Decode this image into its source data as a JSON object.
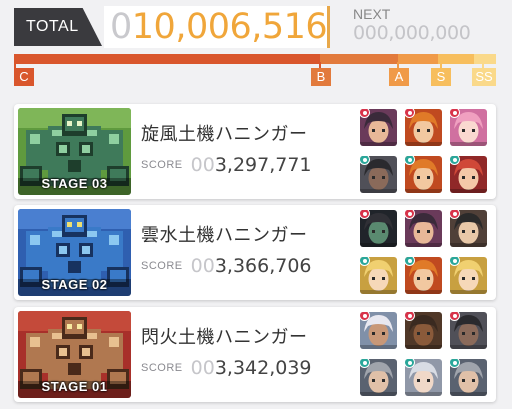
{
  "header": {
    "total_label": "TOTAL",
    "total_lead": "0",
    "total_value": "10,006,516",
    "next_label": "NEXT",
    "next_value": "000,000,000"
  },
  "rank_bar": {
    "colors": {
      "c": "#d9562c",
      "b": "#e27a3c",
      "a": "#f09a48",
      "s": "#f7be5d",
      "ss": "#fad98a"
    },
    "ranks": [
      "C",
      "B",
      "A",
      "S",
      "SS"
    ]
  },
  "stages": [
    {
      "stage_label": "STAGE 03",
      "boss_name": "旋風土機ハニンガー",
      "score_label": "SCORE",
      "score_lead": "00",
      "score_value": "3,297,771",
      "theme": "green",
      "party": [
        {
          "mark": "red",
          "tone": "dark-hair-character"
        },
        {
          "mark": "red",
          "tone": "orange-hair-character"
        },
        {
          "mark": "red",
          "tone": "pink-hair-character"
        },
        {
          "mark": "teal",
          "tone": "dark-character"
        },
        {
          "mark": "teal",
          "tone": "orange-hair-character"
        },
        {
          "mark": "teal",
          "tone": "red-hair-character"
        }
      ]
    },
    {
      "stage_label": "STAGE 02",
      "boss_name": "雲水土機ハニンガー",
      "score_label": "SCORE",
      "score_lead": "00",
      "score_value": "3,366,706",
      "theme": "blue",
      "party": [
        {
          "mark": "red",
          "tone": "masked-character"
        },
        {
          "mark": "red",
          "tone": "dark-hair-character"
        },
        {
          "mark": "red",
          "tone": "glasses-character"
        },
        {
          "mark": "teal",
          "tone": "blonde-character"
        },
        {
          "mark": "teal",
          "tone": "orange-hair-character"
        },
        {
          "mark": "teal",
          "tone": "blonde-character"
        }
      ]
    },
    {
      "stage_label": "STAGE 01",
      "boss_name": "閃火土機ハニンガー",
      "score_label": "SCORE",
      "score_lead": "00",
      "score_value": "3,342,039",
      "theme": "red",
      "party": [
        {
          "mark": "red",
          "tone": "white-hair-character"
        },
        {
          "mark": "red",
          "tone": "dark-skin-character"
        },
        {
          "mark": "red",
          "tone": "dark-character"
        },
        {
          "mark": "teal",
          "tone": "grey-hair-character"
        },
        {
          "mark": "teal",
          "tone": "silver-hair-character"
        },
        {
          "mark": "teal",
          "tone": "grey-hair-character"
        }
      ]
    }
  ]
}
